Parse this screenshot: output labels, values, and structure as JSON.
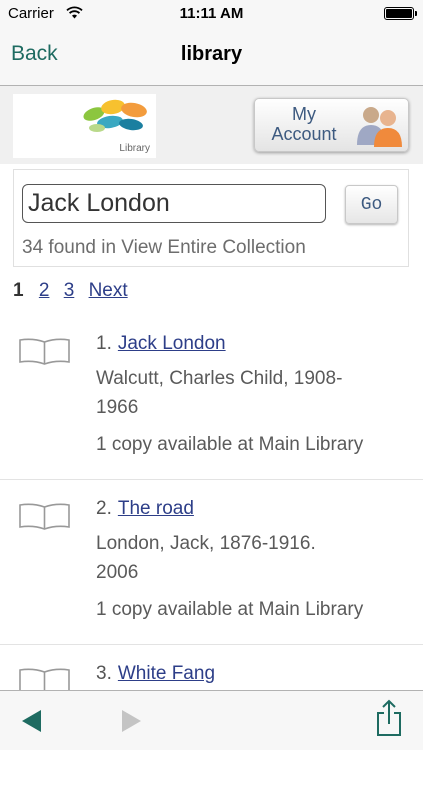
{
  "status_bar": {
    "carrier": "Carrier",
    "time": "11:11 AM"
  },
  "nav": {
    "back_label": "Back",
    "title": "library"
  },
  "header": {
    "logo_text": "Library",
    "account_button": {
      "line1": "My",
      "line2": "Account"
    }
  },
  "search": {
    "value": "Jack London",
    "go_label": "Go",
    "result_count": "34 found in View Entire Collection"
  },
  "pagination": {
    "current": "1",
    "pages": [
      "2",
      "3"
    ],
    "next_label": "Next"
  },
  "results": [
    {
      "number": "1.",
      "title": "Jack London",
      "author_line1": "Walcutt, Charles Child, 1908-",
      "author_line2": "1966",
      "availability": "1 copy available at Main Library"
    },
    {
      "number": "2.",
      "title": "The road",
      "author_line1": "London, Jack, 1876-1916.",
      "author_line2": "2006",
      "availability": "1 copy available at Main Library"
    },
    {
      "number": "3.",
      "title": "White Fang",
      "author_line1": "",
      "author_line2": "",
      "availability": ""
    }
  ],
  "colors": {
    "link": "#2d3e88",
    "nav_back": "#1e6b61",
    "toolbar_icon": "#1e6b61"
  },
  "icons": [
    "wifi-icon",
    "battery-icon",
    "person-icon",
    "book-icon",
    "back-arrow-icon",
    "forward-arrow-icon",
    "share-icon"
  ]
}
